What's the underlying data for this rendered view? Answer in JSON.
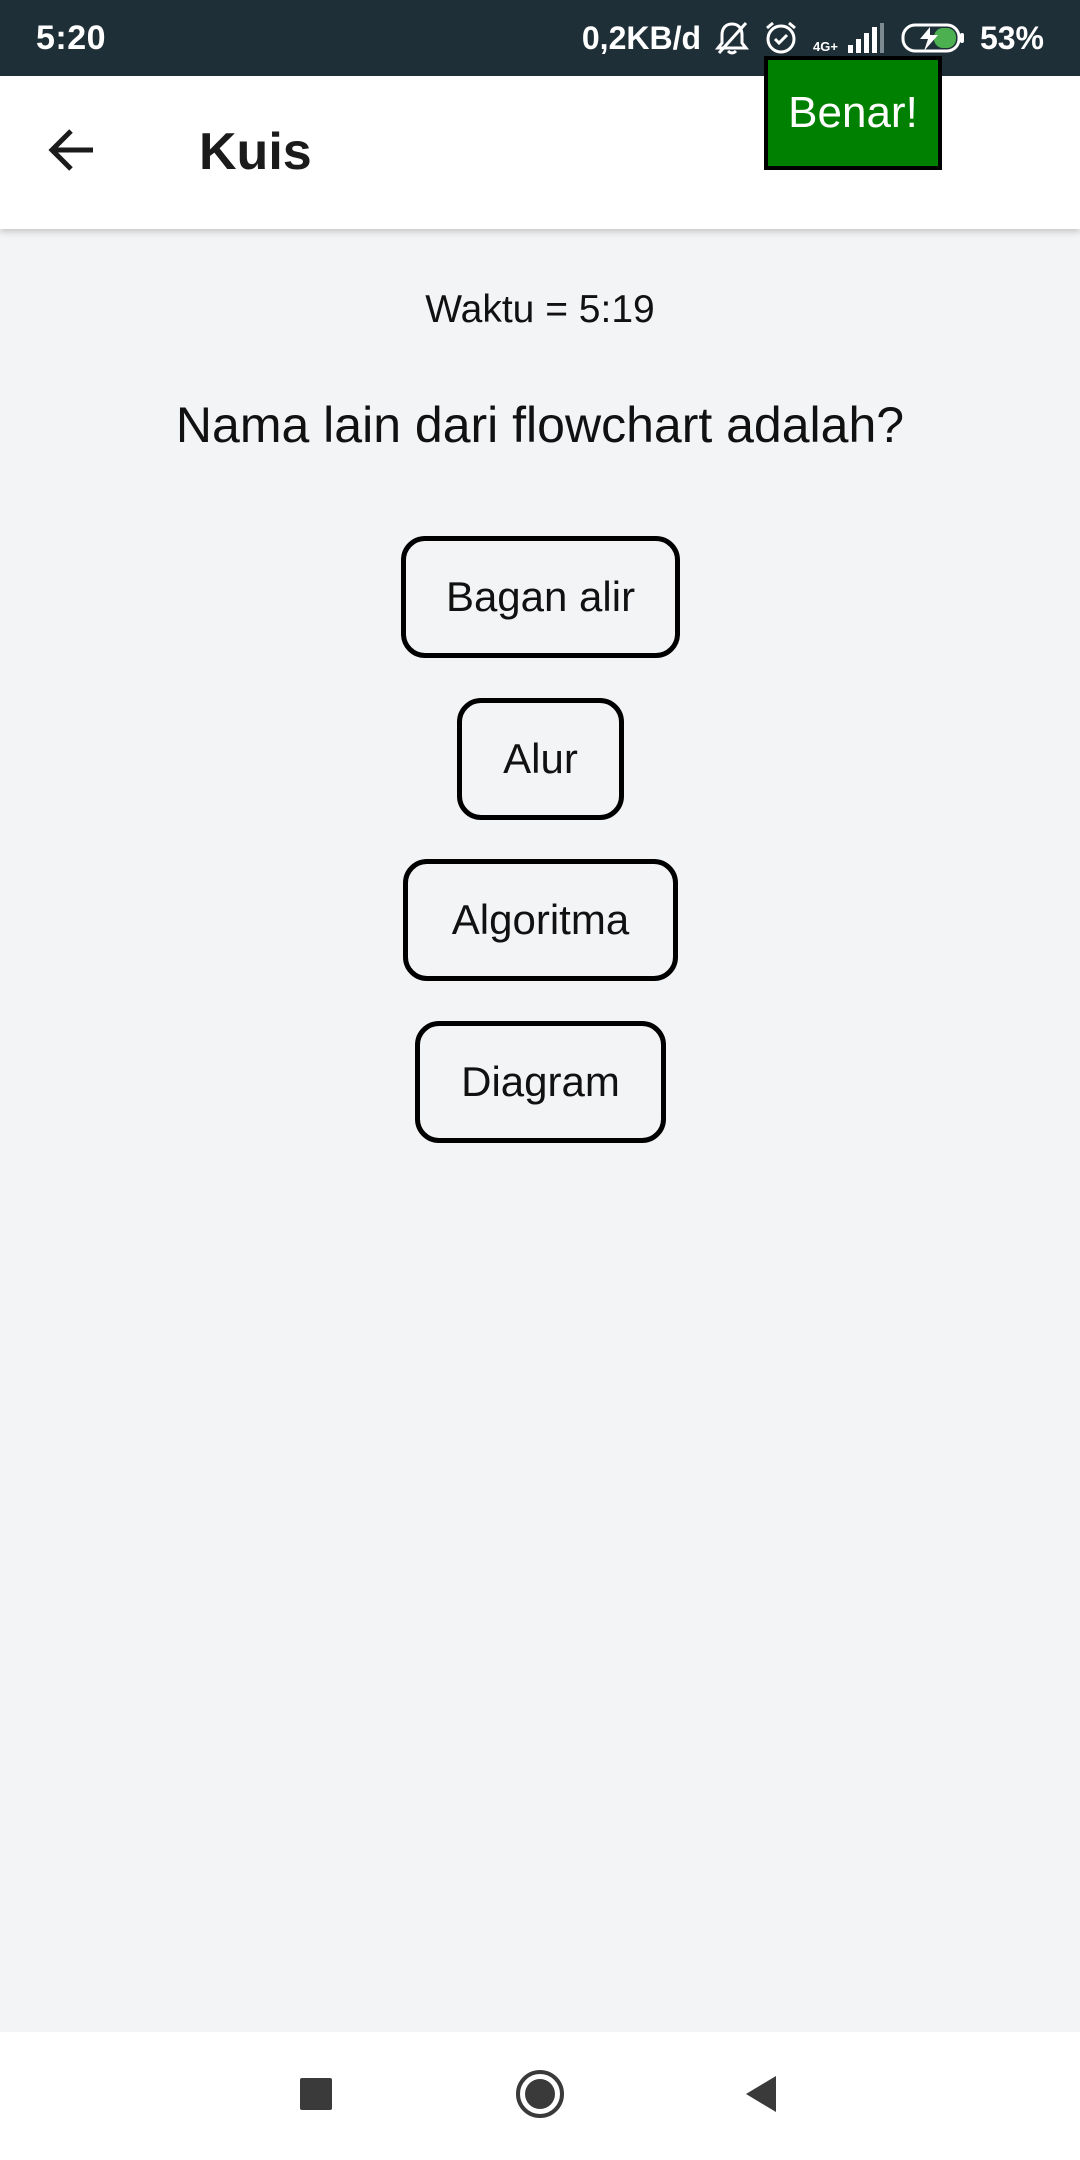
{
  "status_bar": {
    "time": "5:20",
    "net_speed": "0,2KB/d",
    "network_type": "4G+",
    "battery": "53%",
    "icons": [
      "bell-off-icon",
      "alarm-icon",
      "signal-icon",
      "battery-charging-icon"
    ]
  },
  "app_bar": {
    "title": "Kuis",
    "back_icon": "arrow-left-icon",
    "result_label": "Benar!"
  },
  "quiz": {
    "timer": "Waktu = 5:19",
    "question": "Nama lain dari flowchart adalah?",
    "answers": [
      {
        "label": "Bagan alir"
      },
      {
        "label": "Alur"
      },
      {
        "label": "Algoritma"
      },
      {
        "label": "Diagram"
      }
    ]
  },
  "navigation": {
    "icons": [
      "recent-apps-icon",
      "home-icon",
      "back-icon"
    ]
  },
  "colors": {
    "status_bar_bg": "#1f2f38",
    "app_bar_bg": "#ffffff",
    "content_bg": "#f3f4f6",
    "result_bg": "#008000",
    "border": "#000000"
  }
}
